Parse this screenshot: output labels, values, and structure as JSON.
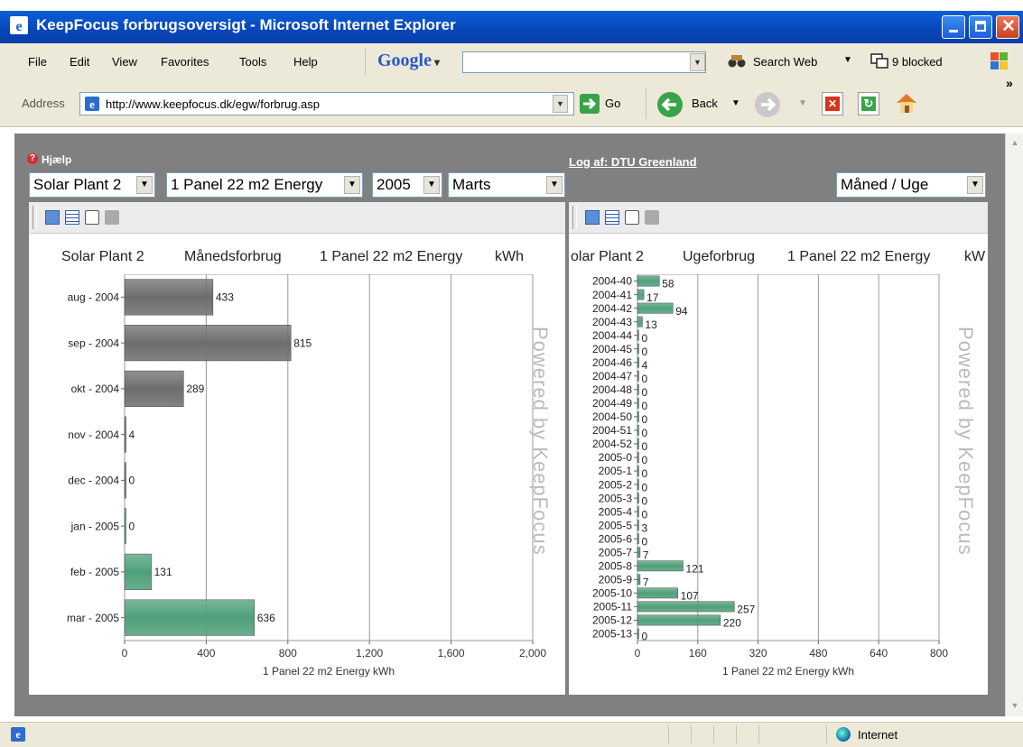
{
  "window": {
    "title": "KeepFocus forbrugsoversigt - Microsoft Internet Explorer"
  },
  "menu": {
    "items": [
      "File",
      "Edit",
      "View",
      "Favorites",
      "Tools",
      "Help"
    ]
  },
  "toolbar": {
    "google": "Google",
    "search_web": "Search Web",
    "blocked": "9 blocked"
  },
  "address": {
    "label": "Address",
    "url": "http://www.keepfocus.dk/egw/forbrug.asp",
    "go": "Go",
    "back": "Back",
    "more": "»"
  },
  "app": {
    "help": "Hjælp",
    "logout": "Log af: DTU Greenland",
    "selects": {
      "plant": "Solar Plant 2",
      "meter": "1 Panel 22 m2 Energy",
      "year": "2005",
      "month": "Marts",
      "period": "Måned / Uge"
    }
  },
  "status": {
    "zone": "Internet"
  },
  "chart_data": [
    {
      "type": "bar",
      "orientation": "horizontal",
      "header": [
        "Solar Plant 2",
        "Månedsforbrug",
        "1 Panel 22 m2 Energy",
        "kWh"
      ],
      "categories": [
        "aug - 2004",
        "sep - 2004",
        "okt - 2004",
        "nov - 2004",
        "dec - 2004",
        "jan - 2005",
        "feb - 2005",
        "mar - 2005"
      ],
      "values": [
        433,
        815,
        289,
        4,
        0,
        0,
        131,
        636
      ],
      "bar_colors": [
        "#6d6d6d",
        "#6d6d6d",
        "#6d6d6d",
        "#6d6d6d",
        "#6d6d6d",
        "#4fa07a",
        "#4fa07a",
        "#4fa07a"
      ],
      "xticks": [
        "0",
        "400",
        "800",
        "1,200",
        "1,600",
        "2,000"
      ],
      "xlim": [
        0,
        2000
      ],
      "xlabel": "1 Panel 22 m2 Energy  kWh",
      "watermark": "Powered by KeepFocus"
    },
    {
      "type": "bar",
      "orientation": "horizontal",
      "header": [
        "olar Plant 2",
        "Ugeforbrug",
        "1 Panel 22 m2 Energy",
        "kW"
      ],
      "categories": [
        "2004-40",
        "2004-41",
        "2004-42",
        "2004-43",
        "2004-44",
        "2004-45",
        "2004-46",
        "2004-47",
        "2004-48",
        "2004-49",
        "2004-50",
        "2004-51",
        "2004-52",
        "2005-0",
        "2005-1",
        "2005-2",
        "2005-3",
        "2005-4",
        "2005-5",
        "2005-6",
        "2005-7",
        "2005-8",
        "2005-9",
        "2005-10",
        "2005-11",
        "2005-12",
        "2005-13"
      ],
      "values": [
        58,
        17,
        94,
        13,
        0,
        0,
        4,
        0,
        0,
        0,
        0,
        0,
        0,
        0,
        0,
        0,
        0,
        0,
        3,
        0,
        7,
        121,
        7,
        107,
        257,
        220,
        0
      ],
      "bar_color": "#4fa07a",
      "xticks": [
        "0",
        "160",
        "320",
        "480",
        "640",
        "800"
      ],
      "xlim": [
        0,
        800
      ],
      "xlabel": "1 Panel 22 m2 Energy  kWh",
      "watermark": "Powered by KeepFocus"
    }
  ]
}
